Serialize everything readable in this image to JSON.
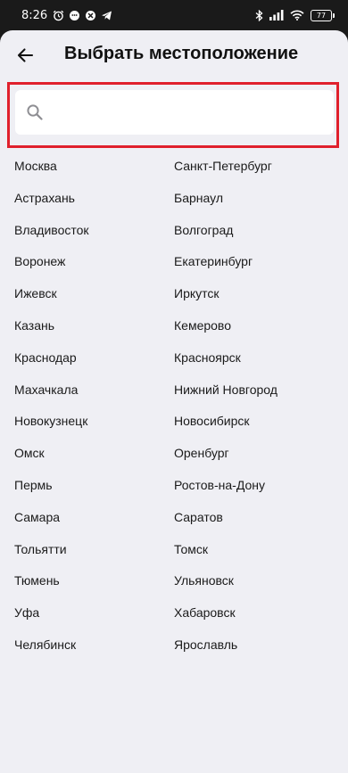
{
  "status_bar": {
    "time": "8:26",
    "battery_level": "77",
    "left_icons": [
      "alarm-icon",
      "chat-icon",
      "app-icon",
      "telegram-icon"
    ],
    "right_icons": [
      "bluetooth-icon",
      "signal-icon",
      "wifi-icon",
      "battery-icon"
    ]
  },
  "header": {
    "title": "Выбрать местоположение",
    "back_icon": "arrow-left-icon"
  },
  "search": {
    "value": "",
    "placeholder": "",
    "icon": "search-icon"
  },
  "colors": {
    "background": "#efeff4",
    "highlight": "#e0202c",
    "text": "#1a1a1a"
  },
  "cities": [
    "Москва",
    "Санкт-Петербург",
    "Астрахань",
    "Барнаул",
    "Владивосток",
    "Волгоград",
    "Воронеж",
    "Екатеринбург",
    "Ижевск",
    "Иркутск",
    "Казань",
    "Кемерово",
    "Краснодар",
    "Красноярск",
    "Махачкала",
    "Нижний Новгород",
    "Новокузнецк",
    "Новосибирск",
    "Омск",
    "Оренбург",
    "Пермь",
    "Ростов-на-Дону",
    "Самара",
    "Саратов",
    "Тольятти",
    "Томск",
    "Тюмень",
    "Ульяновск",
    "Уфа",
    "Хабаровск",
    "Челябинск",
    "Ярославль"
  ]
}
